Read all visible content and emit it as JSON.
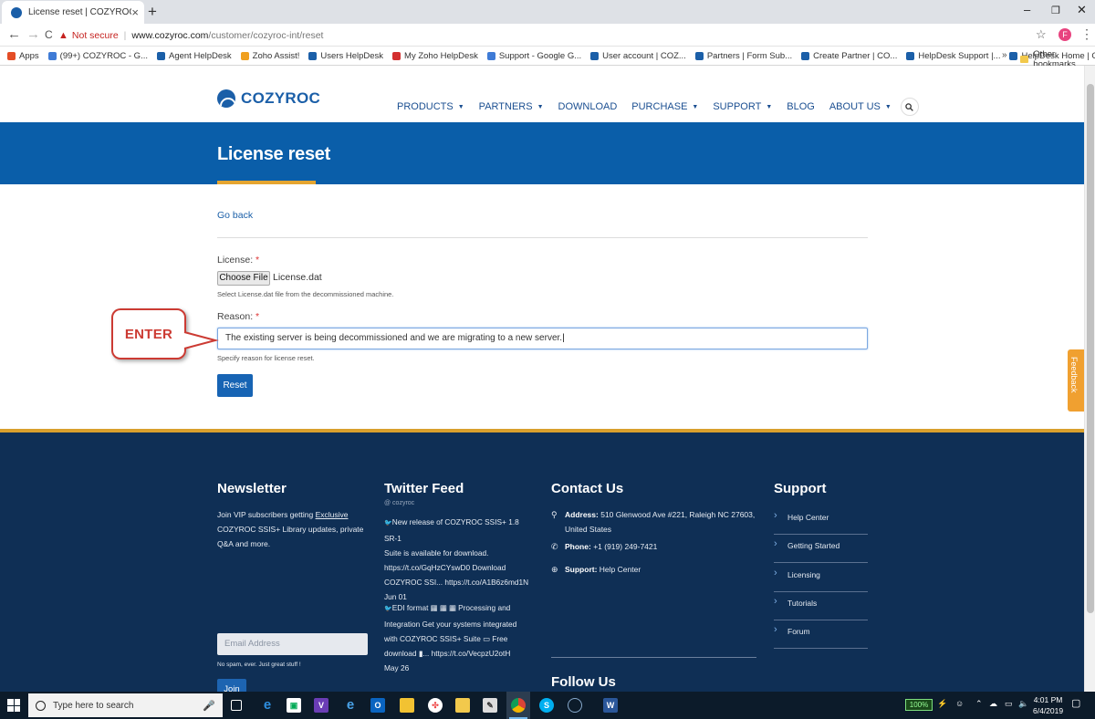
{
  "browser": {
    "tab_title": "License reset | COZYROC",
    "new_tab": "+",
    "tab_close": "×",
    "win_min": "–",
    "win_max": "❐",
    "win_close": "✕",
    "back": "←",
    "forward": "→",
    "reload": "C",
    "not_secure": "Not secure",
    "url_host": "www.cozyroc.com",
    "url_path": "/customer/cozyroc-int/reset",
    "profile_initial": "F",
    "bookmarks": [
      {
        "label": "Apps",
        "color": "#e44d26"
      },
      {
        "label": "(99+) COZYROC - G...",
        "color": "#3f7bd6"
      },
      {
        "label": "Agent HelpDesk",
        "color": "#1b5fa8"
      },
      {
        "label": "Zoho Assist!",
        "color": "#f0a020"
      },
      {
        "label": "Users HelpDesk",
        "color": "#1b5fa8"
      },
      {
        "label": "My Zoho HelpDesk",
        "color": "#d32f2f"
      },
      {
        "label": "Support - Google G...",
        "color": "#3f7bd6"
      },
      {
        "label": "User account | COZ...",
        "color": "#1b5fa8"
      },
      {
        "label": "Partners | Form Sub...",
        "color": "#1b5fa8"
      },
      {
        "label": "Create Partner | CO...",
        "color": "#1b5fa8"
      },
      {
        "label": "HelpDesk Support |...",
        "color": "#1b5fa8"
      },
      {
        "label": "HelpDesk Home | C...",
        "color": "#1b5fa8"
      }
    ],
    "bookmarks_more": "»",
    "other_bookmarks": "Other bookmarks"
  },
  "site": {
    "logo_text": "COZYROC",
    "nav": [
      {
        "label": "PRODUCTS",
        "dropdown": true
      },
      {
        "label": "PARTNERS",
        "dropdown": true
      },
      {
        "label": "DOWNLOAD",
        "dropdown": false
      },
      {
        "label": "PURCHASE",
        "dropdown": true
      },
      {
        "label": "SUPPORT",
        "dropdown": true
      },
      {
        "label": "BLOG",
        "dropdown": false
      },
      {
        "label": "ABOUT US",
        "dropdown": true
      }
    ],
    "caret": "▼",
    "search_icon": "🔍"
  },
  "page": {
    "title": "License reset",
    "go_back": "Go back",
    "license_label": "License:",
    "required_mark": "*",
    "choose_file": "Choose File",
    "file_name": "License.dat",
    "license_hint": "Select License.dat file from the decommissioned machine.",
    "reason_label": "Reason:",
    "reason_value": "The existing server is being decommissioned and we are migrating to a new server.",
    "reason_hint": "Specify reason for license reset.",
    "reset_button": "Reset",
    "callout_text": "ENTER",
    "feedback_tab": "Feedback"
  },
  "footer": {
    "newsletter_title": "Newsletter",
    "newsletter_text_1": "Join VIP subscribers getting ",
    "newsletter_text_link": "Exclusive",
    "newsletter_text_2": "COZYROC SSIS+ Library updates, private",
    "newsletter_text_3": "Q&A and more.",
    "email_placeholder": "Email Address",
    "no_spam": "No spam, ever. Just great stuff !",
    "join_button": "Join",
    "twitter_title": "Twitter Feed",
    "twitter_handle": "@ cozyroc",
    "tweet1": [
      "New release of COZYROC SSIS+ 1.8 SR-1",
      "Suite is available for download.",
      "https://t.co/GqHzCYswD0 Download",
      "COZYROC SSI... https://t.co/A1B6z6md1N",
      "Jun 01"
    ],
    "tweet2": [
      "EDI format ▦ ▦ ▦ Processing and",
      "Integration Get your systems integrated",
      "with COZYROC SSIS+ Suite ▭ Free",
      "download ▮... https://t.co/VecpzU2otH",
      "May 26"
    ],
    "contact_title": "Contact Us",
    "address_label": "Address:",
    "address_value": "510 Glenwood Ave #221, Raleigh NC 27603,",
    "address_value_2": "United States",
    "phone_label": "Phone:",
    "phone_value": "+1 (919) 249-7421",
    "support_label": "Support:",
    "support_value": "Help Center",
    "follow_title": "Follow Us",
    "twitter_btn": "t",
    "linkedin_btn": "in",
    "support_title": "Support",
    "support_links": [
      "Help Center",
      "Getting Started",
      "Licensing",
      "Tutorials",
      "Forum"
    ]
  },
  "taskbar": {
    "search_placeholder": "Type here to search",
    "battery": "100%",
    "time": "4:01 PM",
    "date": "6/4/2019"
  }
}
